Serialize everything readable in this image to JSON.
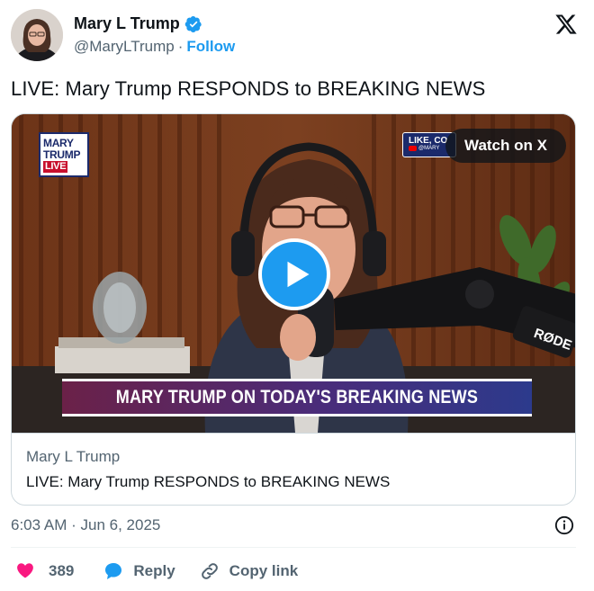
{
  "author": {
    "display_name": "Mary L Trump",
    "handle": "@MaryLTrump",
    "separator": "·",
    "follow_label": "Follow",
    "verified_icon": "verified-badge-icon",
    "avatar_icon": "avatar"
  },
  "brand_icon": "x-logo-icon",
  "tweet": {
    "text": "LIVE: Mary Trump RESPONDS to BREAKING NEWS"
  },
  "video": {
    "watch_label": "Watch on X",
    "play_icon": "play-icon",
    "channel_logo_lines": [
      "MARY",
      "TRUMP",
      "LIVE"
    ],
    "like_badge_text": "LIKE, CO",
    "like_badge_sub": "@MARY",
    "lower_third": "MARY TRUMP ON TODAY'S BREAKING NEWS",
    "mic_brand": "RØDE"
  },
  "card": {
    "source": "Mary L Trump",
    "title": "LIVE: Mary Trump RESPONDS to BREAKING NEWS"
  },
  "meta": {
    "time": "6:03 AM",
    "separator": "·",
    "date": "Jun 6, 2025"
  },
  "actions": {
    "like_count": "389",
    "reply_label": "Reply",
    "copy_link_label": "Copy link"
  },
  "colors": {
    "accent": "#1d9bf0",
    "like": "#f91880",
    "text_secondary": "#536471"
  }
}
